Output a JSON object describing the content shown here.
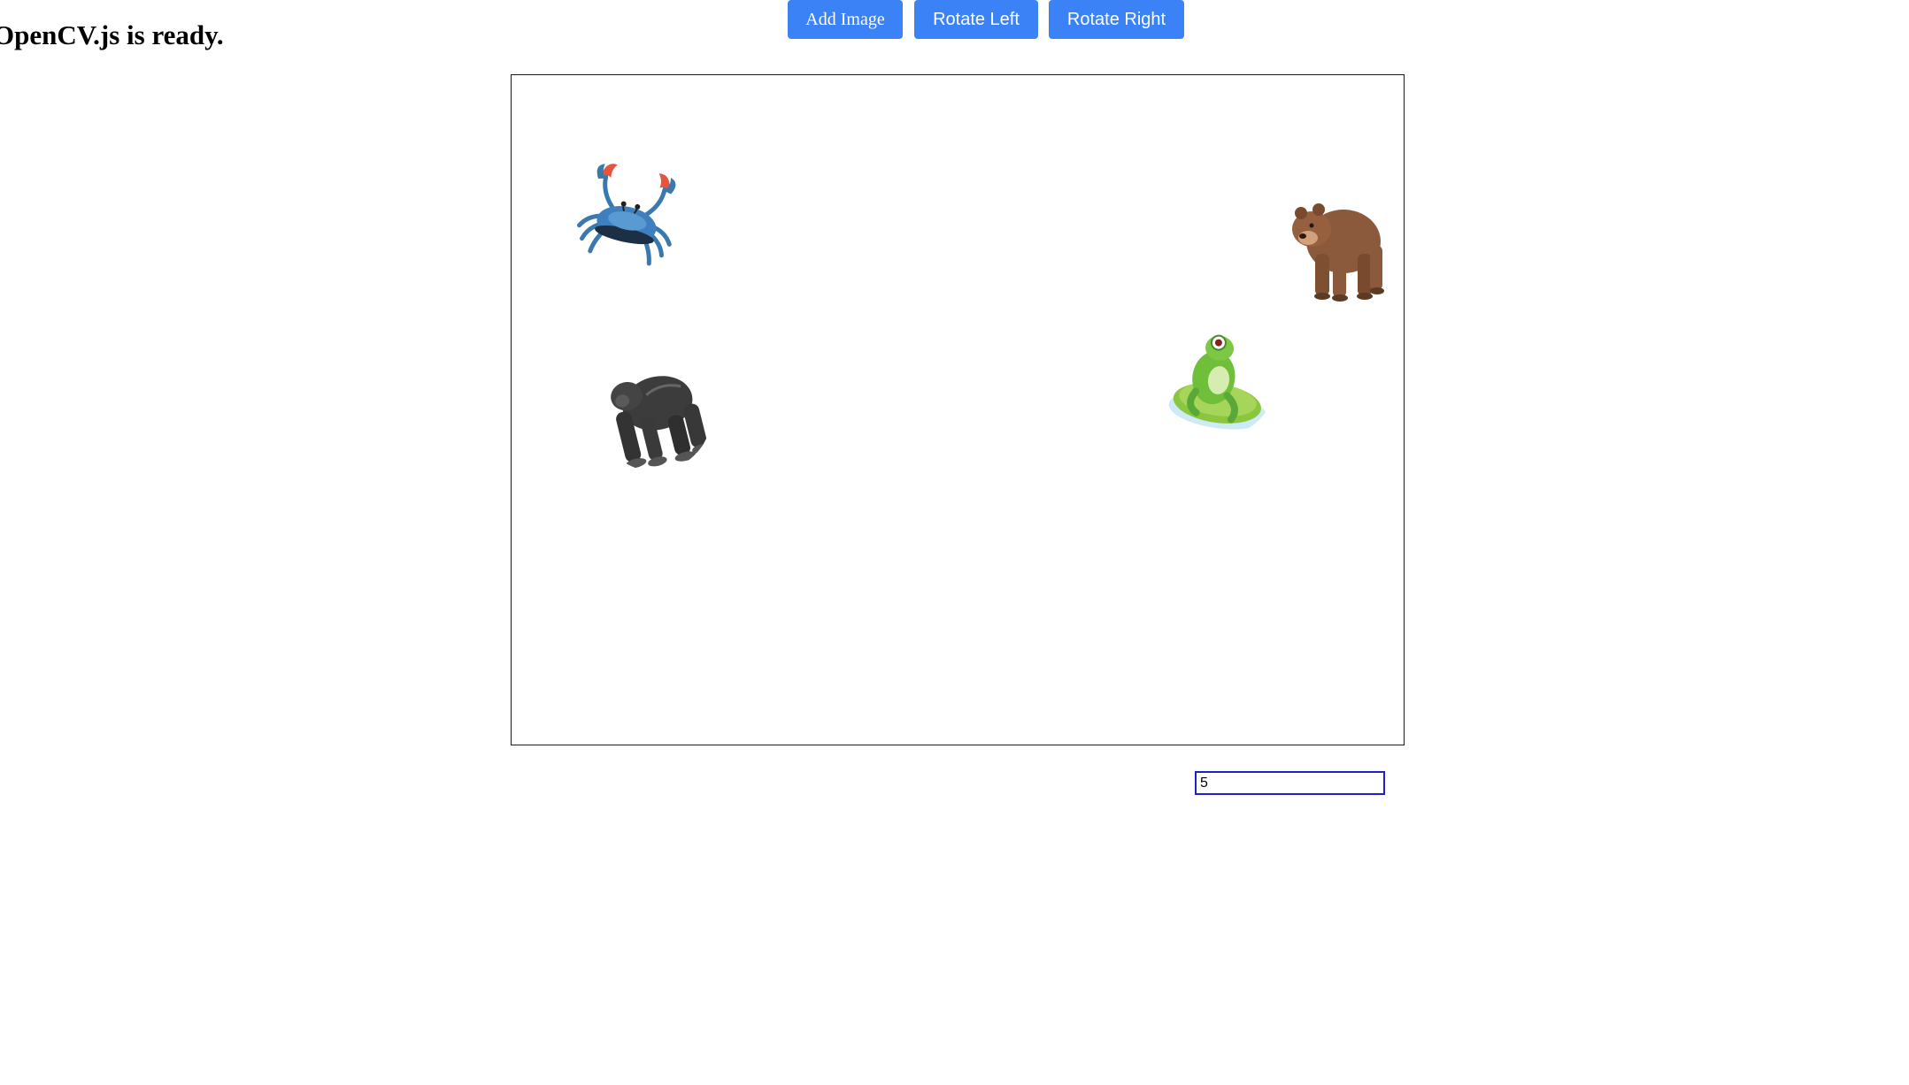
{
  "status": {
    "text": "OpenCV.js is ready."
  },
  "canvas": {
    "images": [
      {
        "name": "crab",
        "icon": "crab-icon"
      },
      {
        "name": "gorilla",
        "icon": "gorilla-icon"
      },
      {
        "name": "frog",
        "icon": "frog-icon"
      },
      {
        "name": "bear",
        "icon": "bear-icon"
      }
    ]
  },
  "toolbar": {
    "add_image_label": "Add Image",
    "rotate_left_label": "Rotate Left",
    "rotate_right_label": "Rotate Right",
    "angle_value": "5"
  },
  "colors": {
    "button": "#3b82f6",
    "input_border": "#1f1fcc"
  }
}
